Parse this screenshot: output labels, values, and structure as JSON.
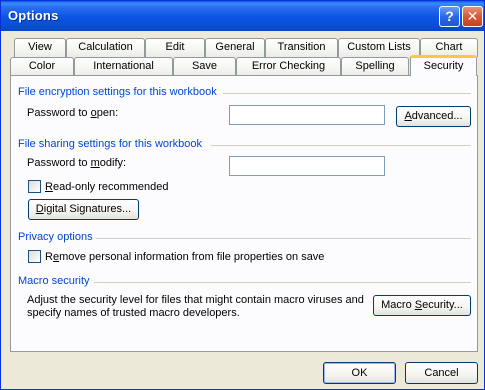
{
  "window": {
    "title": "Options",
    "help_glyph": "?",
    "close_glyph": "✕"
  },
  "tabs": {
    "row1": [
      "View",
      "Calculation",
      "Edit",
      "General",
      "Transition",
      "Custom Lists",
      "Chart"
    ],
    "row2": [
      "Color",
      "International",
      "Save",
      "Error Checking",
      "Spelling",
      "Security"
    ],
    "active": "Security"
  },
  "encryption": {
    "title": "File encryption settings for this workbook",
    "password_label": "Password to open:",
    "password_value": "",
    "advanced_button": "Advanced..."
  },
  "sharing": {
    "title": "File sharing settings for this workbook",
    "password_label": "Password to modify:",
    "password_value": "",
    "readonly_label": "Read-only recommended",
    "readonly_checked": false,
    "signatures_button": "Digital Signatures..."
  },
  "privacy": {
    "title": "Privacy options",
    "remove_info_label": "Remove personal information from file properties on save",
    "remove_info_checked": false
  },
  "macro": {
    "title": "Macro security",
    "description_line1": "Adjust the security level for files that might contain macro viruses and",
    "description_line2": "specify names of trusted macro developers.",
    "button": "Macro Security..."
  },
  "footer": {
    "ok": "OK",
    "cancel": "Cancel"
  }
}
